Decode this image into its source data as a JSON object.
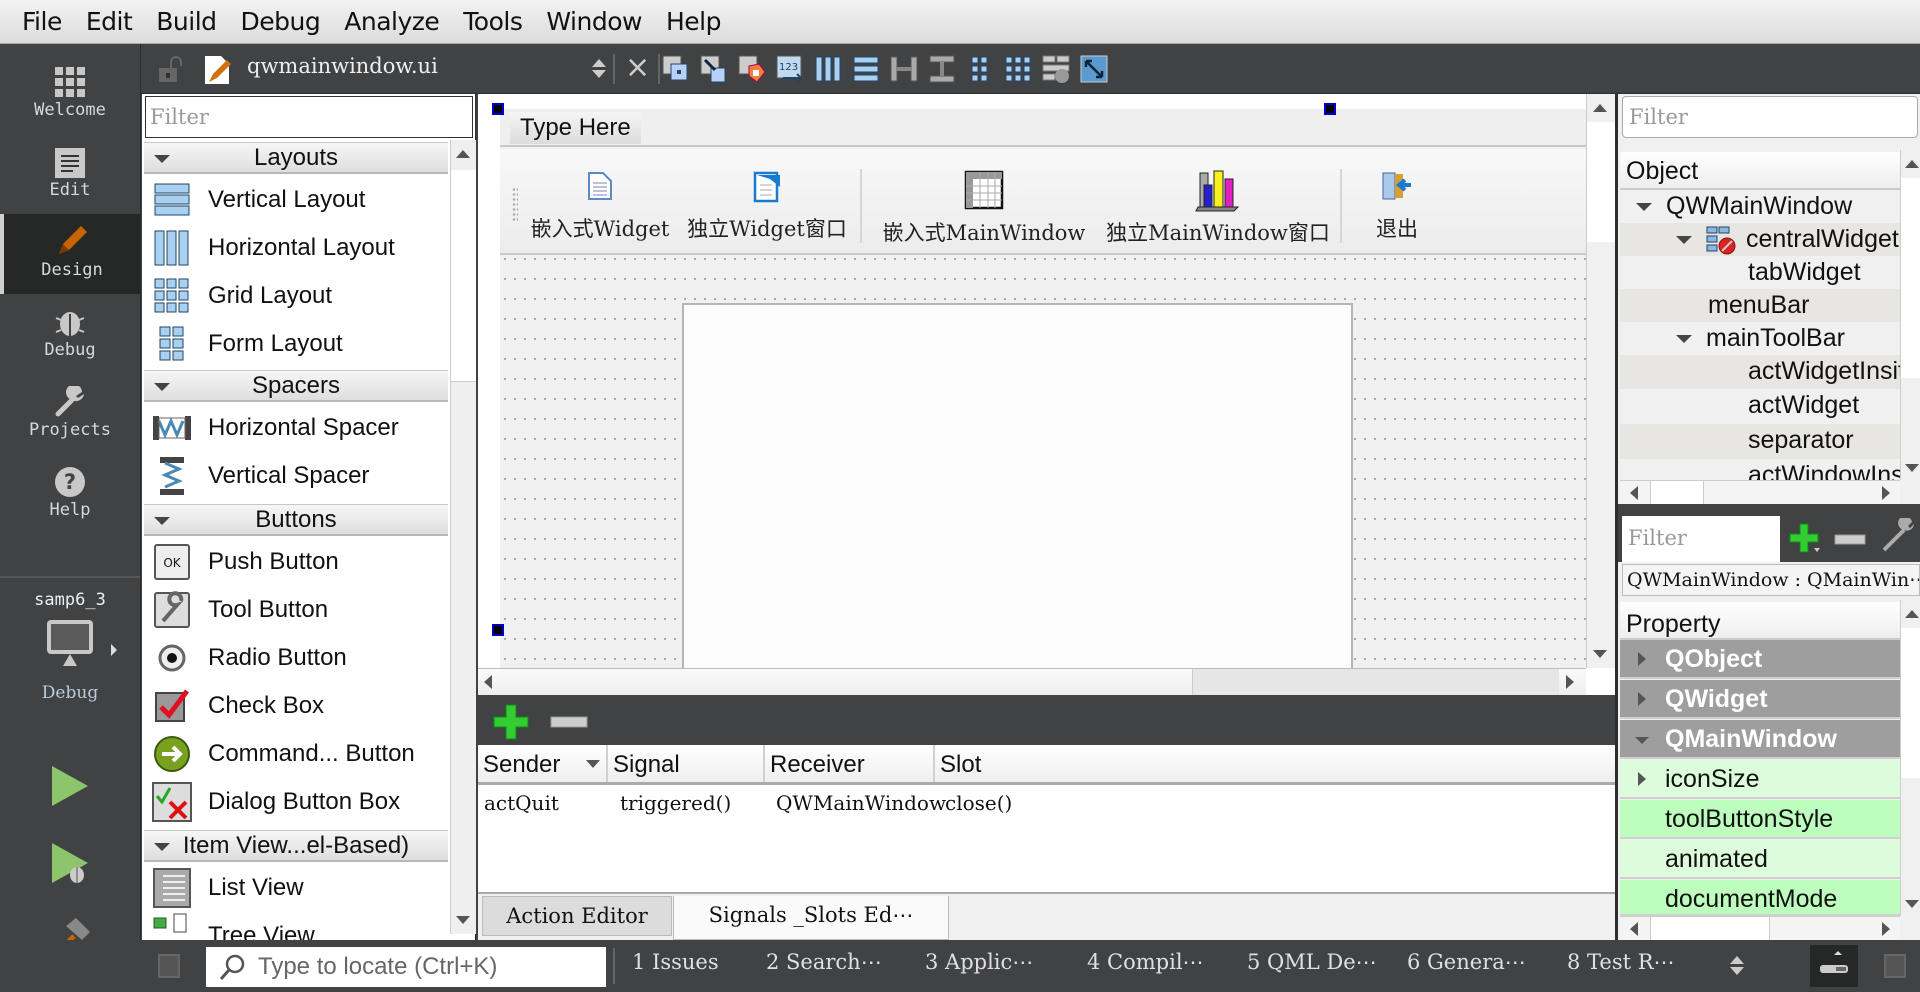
{
  "menu": [
    "File",
    "Edit",
    "Build",
    "Debug",
    "Analyze",
    "Tools",
    "Window",
    "Help"
  ],
  "modes": [
    {
      "label": "Welcome",
      "icon": "grid-icon"
    },
    {
      "label": "Edit",
      "icon": "document-icon"
    },
    {
      "label": "Design",
      "icon": "pencil-icon",
      "active": true
    },
    {
      "label": "Debug",
      "icon": "bug-icon"
    },
    {
      "label": "Projects",
      "icon": "wrench-icon"
    },
    {
      "label": "Help",
      "icon": "help-icon"
    }
  ],
  "kit": {
    "project": "samp6_3",
    "build": "Debug"
  },
  "editor_toolbar": {
    "file_name": "qwmainwindow.ui",
    "tools": [
      "edit-widgets",
      "edit-signals-slots",
      "edit-buddies",
      "edit-tab-order",
      "lay-out-horizontally",
      "lay-out-vertically",
      "lay-out-horizontally-splitter",
      "lay-out-vertically-splitter",
      "lay-out-form",
      "lay-out-grid",
      "break-layout",
      "adjust-size"
    ]
  },
  "widget_box": {
    "filter_placeholder": "Filter",
    "categories": [
      {
        "name": "Layouts",
        "items": [
          "Vertical Layout",
          "Horizontal Layout",
          "Grid Layout",
          "Form Layout"
        ]
      },
      {
        "name": "Spacers",
        "items": [
          "Horizontal Spacer",
          "Vertical Spacer"
        ]
      },
      {
        "name": "Buttons",
        "items": [
          "Push Button",
          "Tool Button",
          "Radio Button",
          "Check Box",
          "Command... Button",
          "Dialog Button Box"
        ]
      },
      {
        "name": "Item View...el-Based)",
        "items": [
          "List View",
          "Tree View"
        ]
      }
    ]
  },
  "form": {
    "menu_placeholder": "Type Here",
    "actions": [
      "嵌入式Widget",
      "独立Widget窗口",
      "嵌入式MainWindow",
      "独立MainWindow窗口",
      "退出"
    ]
  },
  "signal_slot": {
    "columns": [
      "Sender",
      "Signal",
      "Receiver",
      "Slot"
    ],
    "rows": [
      [
        "actQuit",
        "triggered()",
        "QWMainWindow",
        "close()"
      ]
    ],
    "tabs": [
      "Action Editor",
      "Signals _Slots Ed⋯"
    ],
    "active_tab": 1
  },
  "object_inspector": {
    "filter_placeholder": "Filter",
    "header": "Object",
    "rows": [
      {
        "name": "QWMainWindow",
        "level": 0,
        "expanded": true
      },
      {
        "name": "centralWidget",
        "level": 1,
        "expanded": true,
        "icon": true
      },
      {
        "name": "tabWidget",
        "level": 2
      },
      {
        "name": "menuBar",
        "level": 1
      },
      {
        "name": "mainToolBar",
        "level": 1,
        "expanded": true
      },
      {
        "name": "actWidgetInsite",
        "level": 2
      },
      {
        "name": "actWidget",
        "level": 2
      },
      {
        "name": "separator",
        "level": 2
      },
      {
        "name": "actWindowInsite",
        "level": 2
      }
    ]
  },
  "property_editor": {
    "filter_placeholder": "Filter",
    "class_label": "QWMainWindow : QMainWin⋯",
    "header": "Property",
    "rows": [
      {
        "name": "QObject",
        "type": "group",
        "expanded": false
      },
      {
        "name": "QWidget",
        "type": "group",
        "expanded": false
      },
      {
        "name": "QMainWindow",
        "type": "group",
        "expanded": true
      },
      {
        "name": "iconSize",
        "type": "prop",
        "shade": 1,
        "expandable": true
      },
      {
        "name": "toolButtonStyle",
        "type": "prop",
        "shade": 2
      },
      {
        "name": "animated",
        "type": "prop",
        "shade": 1
      },
      {
        "name": "documentMode",
        "type": "prop",
        "shade": 2
      }
    ]
  },
  "status_bar": {
    "locate_placeholder": "Type to locate (Ctrl+K)",
    "panes": [
      "1 Issues",
      "2 Search⋯",
      "3 Applic⋯",
      "4 Compil⋯",
      "5 QML De⋯",
      "6 Genera⋯",
      "8 Test R⋯"
    ]
  },
  "colors": {
    "accent_orange": "#c86400",
    "run_green": "#8cc56c",
    "prop_group": "#9e9e9e",
    "prop_light": "#dcfcdc",
    "prop_dark": "#bdfdbd"
  }
}
